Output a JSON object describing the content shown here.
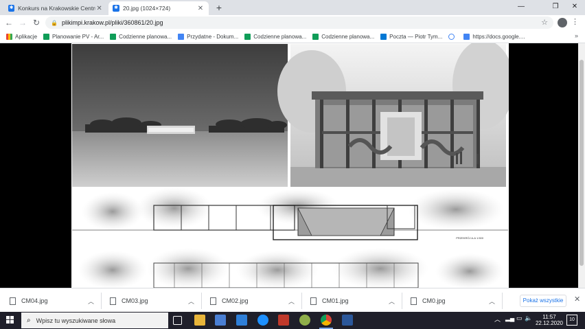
{
  "browser": {
    "tabs": [
      {
        "title": "Konkurs na Krakowskie Centrum"
      },
      {
        "title": "20.jpg (1024×724)"
      }
    ],
    "new_tab_symbol": "+",
    "address": {
      "url": "plikimpi.krakow.pl/pliki/360861/20.jpg"
    },
    "bookmarks": [
      {
        "label": "Aplikacje",
        "icon": "apps-icon"
      },
      {
        "label": "Planowanie PV - Ar...",
        "icon": "sheets-icon"
      },
      {
        "label": "Codzienne planowa...",
        "icon": "sheets-icon"
      },
      {
        "label": "Przydatne - Dokum...",
        "icon": "docs-icon"
      },
      {
        "label": "Codzienne planowa...",
        "icon": "sheets-icon"
      },
      {
        "label": "Codzienne planowa...",
        "icon": "sheets-icon"
      },
      {
        "label": "Poczta — Piotr Tym...",
        "icon": "outlook-icon"
      },
      {
        "label": "",
        "icon": "google-icon"
      },
      {
        "label": "https://docs.google....",
        "icon": "docs-icon"
      }
    ],
    "bookmarks_more": "»"
  },
  "image": {
    "section_label": "PRZEKRÓJ A-A 1:500"
  },
  "downloads": {
    "items": [
      {
        "name": "CM04.jpg"
      },
      {
        "name": "CM03.jpg"
      },
      {
        "name": "CM02.jpg"
      },
      {
        "name": "CM01.jpg"
      },
      {
        "name": "CM0.jpg"
      }
    ],
    "show_all": "Pokaż wszystkie"
  },
  "taskbar": {
    "search_placeholder": "Wpisz tu wyszukiwane słowa",
    "time": "11:57",
    "date": "22.12.2020",
    "notifications": "10"
  }
}
